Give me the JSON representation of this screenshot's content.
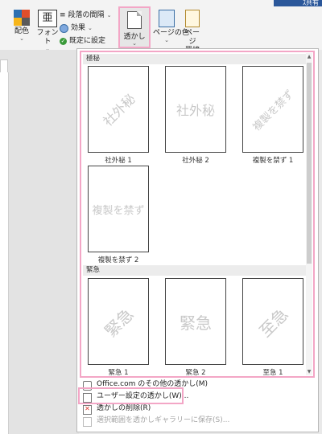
{
  "ribbon": {
    "top_right": "ｽ共有",
    "colors_label": "配色",
    "fonts_label": "フォント",
    "paragraph_spacing": "段落の間隔",
    "effects": "効果",
    "set_default": "既定に設定",
    "watermark_label": "透かし",
    "page_color_label": "ページの色",
    "page_borders_label1": "ページ",
    "page_borders_label2": "罫線",
    "chevron": "⌄"
  },
  "gallery": {
    "section_confidential": "極秘",
    "section_urgent": "緊急",
    "tiles_confidential": [
      {
        "text": "社外秘",
        "label": "社外秘 1"
      },
      {
        "text": "社外秘",
        "label": "社外秘 2"
      },
      {
        "text": "複製を禁ず",
        "label": "複製を禁ず 1"
      },
      {
        "text": "複製を禁ず",
        "label": "複製を禁ず 2"
      }
    ],
    "tiles_urgent": [
      {
        "text": "緊急",
        "label": "緊急 1"
      },
      {
        "text": "緊急",
        "label": "緊急 2"
      },
      {
        "text": "至急",
        "label": "至急 1"
      }
    ]
  },
  "menu": {
    "more_watermarks": "Office.com のその他の透かし(M)",
    "custom_watermark": "ユーザー設定の透かし(W)...",
    "remove_watermark": "透かしの削除(R)",
    "save_selection": "選択範囲を透かしギャラリーに保存(S)..."
  },
  "colors": {
    "highlight": "#f3a6c6",
    "accent_blue": "#2b579a",
    "watermark_gray": "#c9c9c9"
  }
}
